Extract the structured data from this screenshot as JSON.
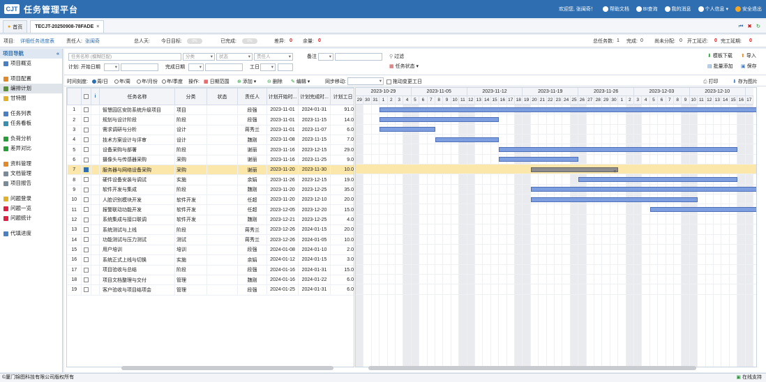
{
  "header": {
    "logo": "CJT",
    "title": "任务管理平台",
    "welcome": "欢迎您, 张闽奇！",
    "links": [
      "帮助文档",
      "BI查询",
      "我的消息",
      "个人信息",
      "安全退出"
    ]
  },
  "tabs": [
    {
      "label": "首页"
    },
    {
      "label": "TECJT-20250908-78FADE"
    }
  ],
  "info": {
    "project_label": "项目:",
    "project": "详细任务进度表",
    "owner_label": "责任人:",
    "owner": "张闽奇",
    "total_days_label": "总人天:",
    "today_target_label": "今日目标:",
    "today_pill": "0%",
    "done_label": "已完成:",
    "done_pill": "0%",
    "diff_label": "差异:",
    "diff": "0",
    "remain_label": "余量:",
    "remain": "0",
    "total_tasks_label": "总任务数:",
    "total_tasks": "1",
    "completed_label": "完成:",
    "completed": "0",
    "unassigned_label": "尚未分配:",
    "unassigned": "0",
    "late_start_label": "开工延迟:",
    "late_start": "0",
    "late_end_label": "完工延期:",
    "late_end": "0"
  },
  "sidebar": {
    "title": "项目导航",
    "items": [
      "项目概览",
      "项目配置",
      "编排计划",
      "甘特图",
      "任务列表",
      "任务看板",
      "负荷分析",
      "差异对比",
      "资料管理",
      "文档管理",
      "项目报告",
      "问题登录",
      "问题一览",
      "问题统计",
      "代填进度"
    ]
  },
  "filters": {
    "task_name_ph": "任务名称 (模糊匹配)",
    "category_ph": "分类",
    "status_ph": "状态",
    "owner_ph": "责任人",
    "remark": "备注",
    "filter": "过滤",
    "task_status": "任务状态",
    "plan": "计划: 开始日期",
    "end_date": "完成日期",
    "workdays": "工日",
    "template_dl": "模板下载",
    "import": "导入",
    "batch_add": "批量添加",
    "save": "保存"
  },
  "toolbar": {
    "scale": "时间刻度:",
    "opts": [
      "周/日",
      "年/周",
      "年/月份",
      "年/季度"
    ],
    "ops": "操作:",
    "date_range": "日期范围",
    "add": "添加",
    "del": "删除",
    "edit": "编辑",
    "sync": "同步移动:",
    "drag": "拖动变更工日",
    "print": "打印",
    "save_img": "存为图片"
  },
  "table": {
    "headers": [
      "",
      "",
      "i",
      "任务名称",
      "分类",
      "状态",
      "责任人",
      "计划开始时...",
      "计划完成时...",
      "计划工日"
    ],
    "rows": [
      [
        "1",
        "智慧园区安防系统升级项目",
        "项目",
        "",
        "段强",
        "2023-11-01",
        "2024-01-31",
        "91.0"
      ],
      [
        "2",
        "规划与设计阶段",
        "阶段",
        "",
        "段强",
        "2023-11-01",
        "2023-11-15",
        "14.0"
      ],
      [
        "3",
        "需求调研与分析",
        "设计",
        "",
        "蒋秀兰",
        "2023-11-01",
        "2023-11-07",
        "6.0"
      ],
      [
        "4",
        "技术方案设计与评审",
        "设计",
        "",
        "魏刚",
        "2023-11-08",
        "2023-11-15",
        "7.0"
      ],
      [
        "5",
        "设备采购与部署",
        "阶段",
        "",
        "谢丽",
        "2023-11-16",
        "2023-12-15",
        "29.0"
      ],
      [
        "6",
        "摄像头与传感器采购",
        "采购",
        "",
        "谢丽",
        "2023-11-16",
        "2023-11-25",
        "9.0"
      ],
      [
        "7",
        "服务器与网络设备采购",
        "采购",
        "",
        "谢丽",
        "2023-11-20",
        "2023-11-30",
        "10.0"
      ],
      [
        "8",
        "硬件设备安装与调试",
        "实施",
        "",
        "余娟",
        "2023-11-26",
        "2023-12-15",
        "19.0"
      ],
      [
        "9",
        "软件开发与集成",
        "阶段",
        "",
        "魏刚",
        "2023-11-20",
        "2023-12-25",
        "35.0"
      ],
      [
        "10",
        "人脸识别模块开发",
        "软件开发",
        "",
        "任超",
        "2023-11-20",
        "2023-12-10",
        "20.0"
      ],
      [
        "11",
        "报警联动功能开发",
        "软件开发",
        "",
        "任超",
        "2023-12-05",
        "2023-12-20",
        "15.0"
      ],
      [
        "12",
        "系统集成与接口联调",
        "软件开发",
        "",
        "魏刚",
        "2023-12-21",
        "2023-12-25",
        "4.0"
      ],
      [
        "13",
        "系统测试与上线",
        "阶段",
        "",
        "蒋秀兰",
        "2023-12-26",
        "2024-01-15",
        "20.0"
      ],
      [
        "14",
        "功能测试与压力测试",
        "测试",
        "",
        "蒋秀兰",
        "2023-12-26",
        "2024-01-05",
        "10.0"
      ],
      [
        "15",
        "用户培训",
        "培训",
        "",
        "段强",
        "2024-01-08",
        "2024-01-10",
        "2.0"
      ],
      [
        "16",
        "系统正式上线与切换",
        "实施",
        "",
        "余娟",
        "2024-01-12",
        "2024-01-15",
        "3.0"
      ],
      [
        "17",
        "项目验收与总结",
        "阶段",
        "",
        "段强",
        "2024-01-16",
        "2024-01-31",
        "15.0"
      ],
      [
        "18",
        "项目文档整理与交付",
        "管理",
        "",
        "魏刚",
        "2024-01-16",
        "2024-01-22",
        "6.0"
      ],
      [
        "19",
        "客户验收与项目结项会",
        "管理",
        "",
        "段强",
        "2024-01-25",
        "2024-01-31",
        "6.0"
      ]
    ],
    "selected_row": 7
  },
  "gantt": {
    "weeks": [
      "2023-10-29",
      "2023-11-05",
      "2023-11-12",
      "2023-11-19",
      "2023-11-26",
      "2023-12-03",
      "2023-12-10"
    ],
    "days": [
      "29",
      "30",
      "31",
      "1",
      "2",
      "3",
      "4",
      "5",
      "6",
      "7",
      "8",
      "9",
      "10",
      "11",
      "12",
      "13",
      "14",
      "15",
      "16",
      "17",
      "18",
      "19",
      "20",
      "21",
      "22",
      "23",
      "24",
      "25",
      "26",
      "27",
      "28",
      "29",
      "30",
      "1",
      "2",
      "3",
      "4",
      "5",
      "6",
      "7",
      "8",
      "9",
      "10",
      "11",
      "12",
      "13",
      "14",
      "15",
      "16",
      "17"
    ]
  },
  "footer": {
    "copyright": "©厦门锦图科技有限公司版权所有",
    "support": "在线支持"
  }
}
